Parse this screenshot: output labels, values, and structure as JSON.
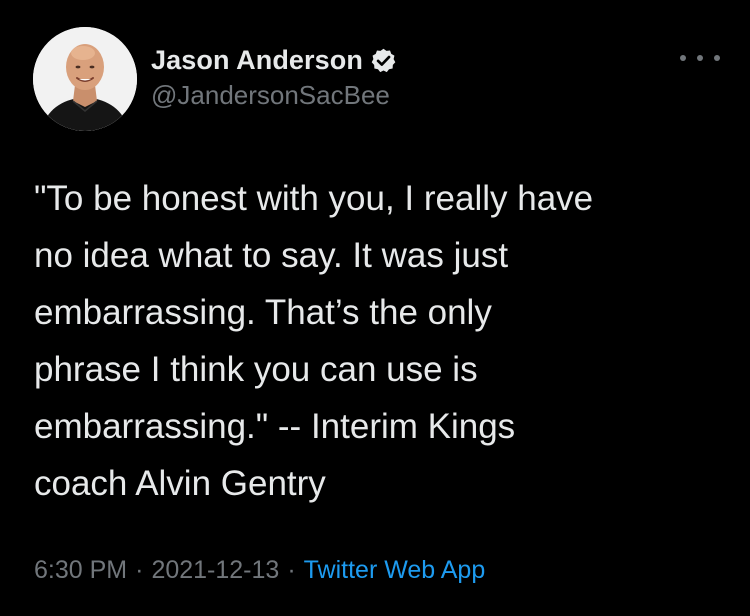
{
  "colors": {
    "background": "#000000",
    "text_primary": "#e7e9ea",
    "text_secondary": "#71767b",
    "link": "#1d9bf0"
  },
  "author": {
    "display_name": "Jason Anderson",
    "handle": "@JandersonSacBee",
    "verified": true,
    "verified_icon": "verified-badge-icon",
    "avatar_icon": "profile-photo"
  },
  "menu": {
    "icon": "more-options-icon"
  },
  "tweet": {
    "text": "\"To be honest with you, I really have\nno idea what to say. It was just\nembarrassing. That’s the only\nphrase I think you can use is\nembarrassing.\" -- Interim Kings\ncoach Alvin Gentry"
  },
  "meta": {
    "time": "6:30 PM",
    "separator1": "·",
    "date": "2021-12-13",
    "separator2": "·",
    "source": "Twitter Web App"
  }
}
